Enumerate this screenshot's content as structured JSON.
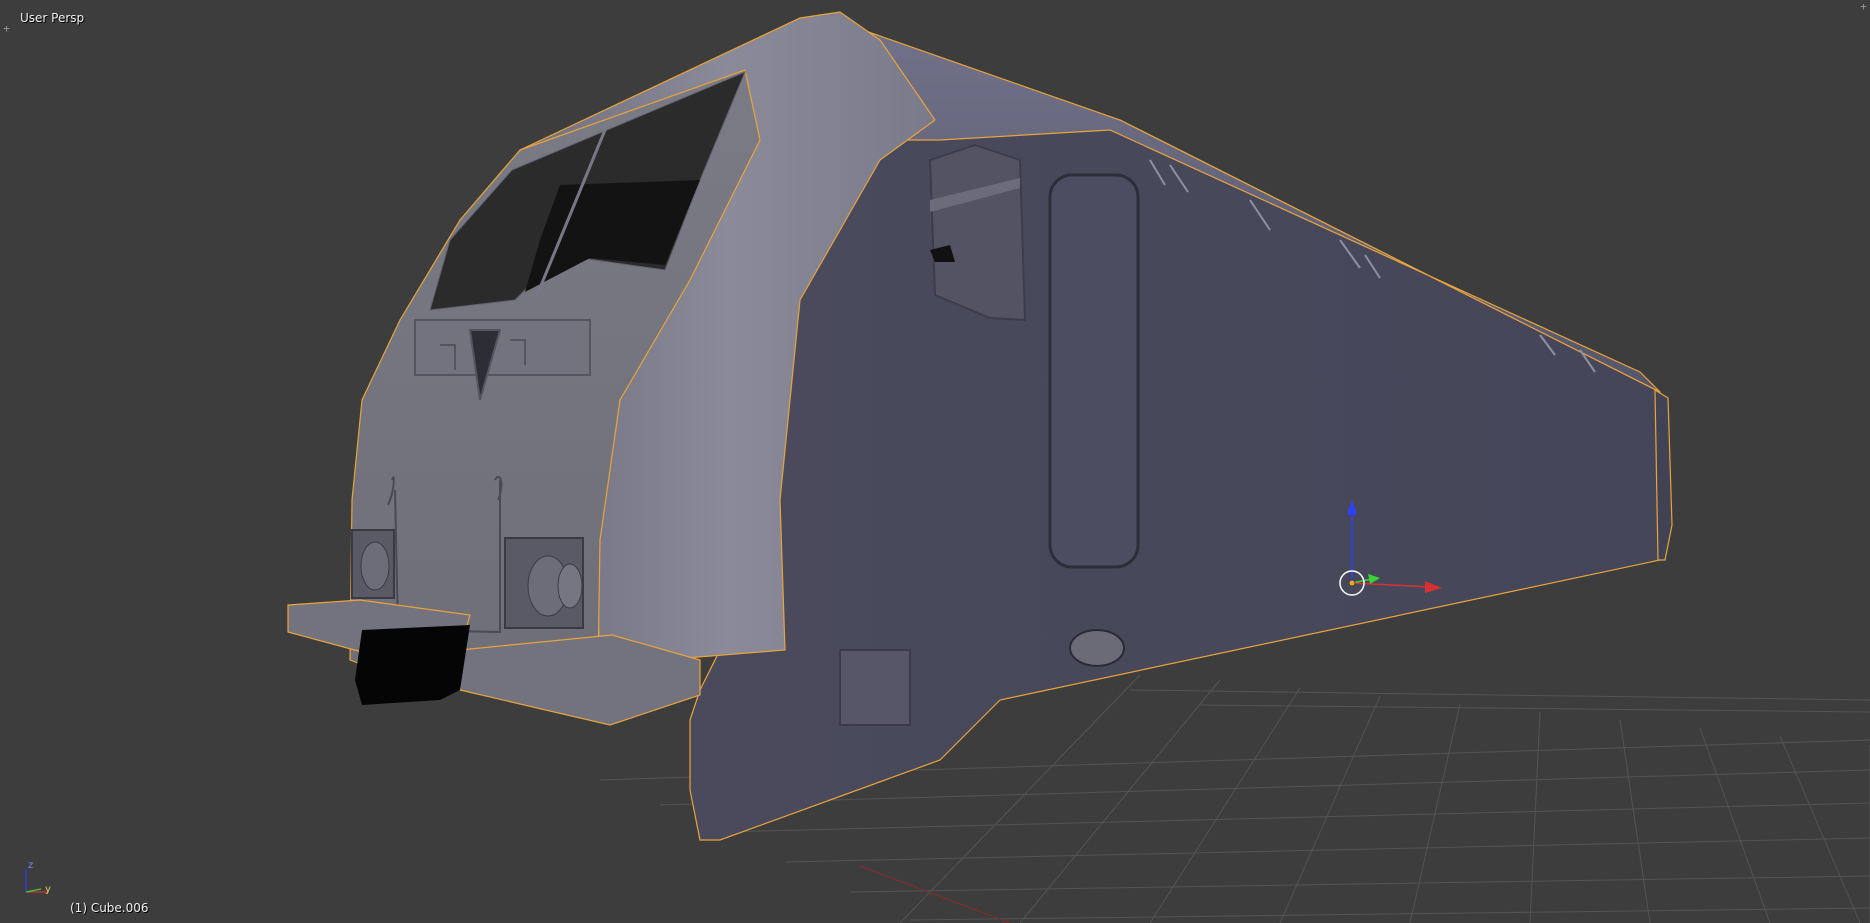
{
  "viewport": {
    "view_name": "User Persp",
    "object_info": "(1) Cube.006",
    "corner_handle_glyph": "+",
    "axis_labels": {
      "z": "z",
      "y": "y"
    }
  },
  "colors": {
    "background": "#3d3d3d",
    "grid": "#545454",
    "selection_outline": "#e8a43c",
    "axis_x": "#d73232",
    "axis_y": "#3ad43a",
    "axis_z": "#2f3fff",
    "mesh_base": "#4d4d61",
    "mesh_light": "#8b8b9a"
  }
}
